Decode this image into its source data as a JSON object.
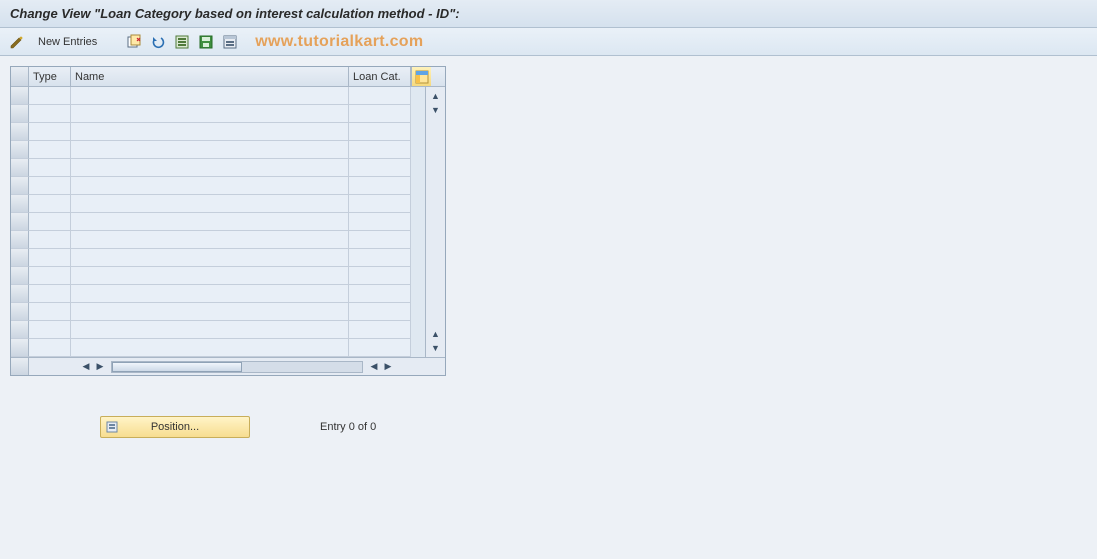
{
  "title": "Change View \"Loan Category based on interest calculation method - ID\":",
  "toolbar": {
    "new_entries_label": "New Entries",
    "icons": {
      "change": "pencil-glasses-icon",
      "copy": "copy-row-icon",
      "undo": "undo-icon",
      "delimit": "select-all-icon",
      "save_variant": "save-green-icon",
      "select_block": "select-block-icon"
    }
  },
  "watermark": "www.tutorialkart.com",
  "grid": {
    "columns": [
      {
        "key": "type",
        "label": "Type"
      },
      {
        "key": "name",
        "label": "Name"
      },
      {
        "key": "loan_cat",
        "label": "Loan Cat."
      }
    ],
    "rows": [
      {
        "type": "",
        "name": "",
        "loan_cat": ""
      },
      {
        "type": "",
        "name": "",
        "loan_cat": ""
      },
      {
        "type": "",
        "name": "",
        "loan_cat": ""
      },
      {
        "type": "",
        "name": "",
        "loan_cat": ""
      },
      {
        "type": "",
        "name": "",
        "loan_cat": ""
      },
      {
        "type": "",
        "name": "",
        "loan_cat": ""
      },
      {
        "type": "",
        "name": "",
        "loan_cat": ""
      },
      {
        "type": "",
        "name": "",
        "loan_cat": ""
      },
      {
        "type": "",
        "name": "",
        "loan_cat": ""
      },
      {
        "type": "",
        "name": "",
        "loan_cat": ""
      },
      {
        "type": "",
        "name": "",
        "loan_cat": ""
      },
      {
        "type": "",
        "name": "",
        "loan_cat": ""
      },
      {
        "type": "",
        "name": "",
        "loan_cat": ""
      },
      {
        "type": "",
        "name": "",
        "loan_cat": ""
      },
      {
        "type": "",
        "name": "",
        "loan_cat": ""
      }
    ],
    "config_icon": "table-settings-icon"
  },
  "footer": {
    "position_label": "Position...",
    "entry_text": "Entry 0 of 0"
  }
}
